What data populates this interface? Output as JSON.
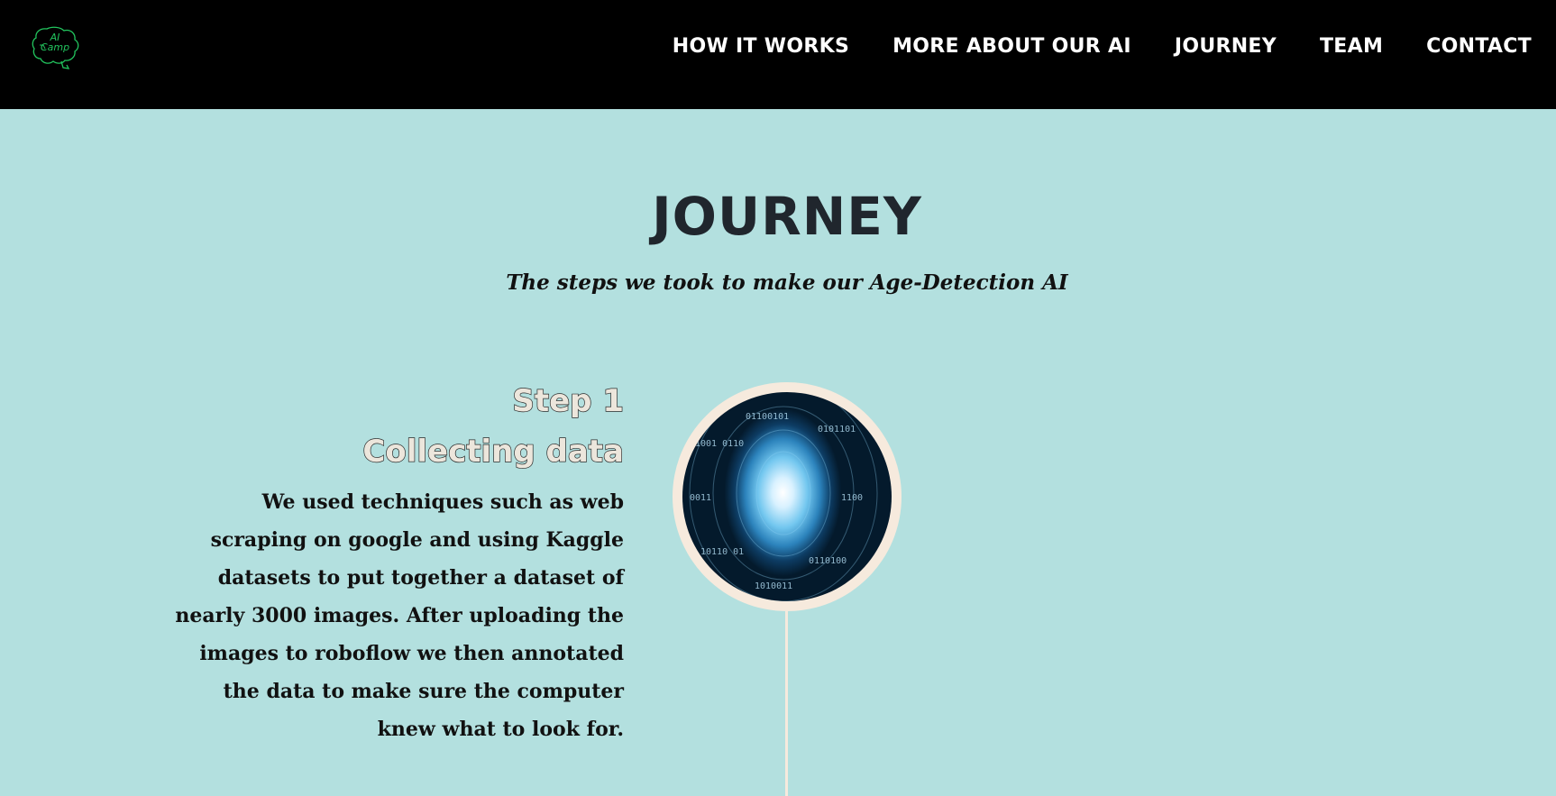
{
  "logo": {
    "line1": "AI",
    "line2": "Camp",
    "color": "#22c55e"
  },
  "nav": {
    "items": [
      {
        "label": "HOW IT WORKS"
      },
      {
        "label": "MORE ABOUT OUR AI"
      },
      {
        "label": "JOURNEY"
      },
      {
        "label": "TEAM"
      },
      {
        "label": "CONTACT"
      }
    ]
  },
  "hero": {
    "title": "JOURNEY",
    "subtitle": "The steps we took to make our Age-Detection AI"
  },
  "steps": [
    {
      "number": "Step 1",
      "title": "Collecting data",
      "description": "We used techniques such as web scraping on google and using Kaggle datasets to put together a dataset of nearly 3000 images. After uploading the images to roboflow we then annotated the data to make sure the computer knew what to look for.",
      "image": "binary-data-tunnel-image"
    }
  ],
  "colors": {
    "background": "#b3e0df",
    "navbar": "#000000",
    "accent_cream": "#f6eadd",
    "title": "#20262d"
  }
}
